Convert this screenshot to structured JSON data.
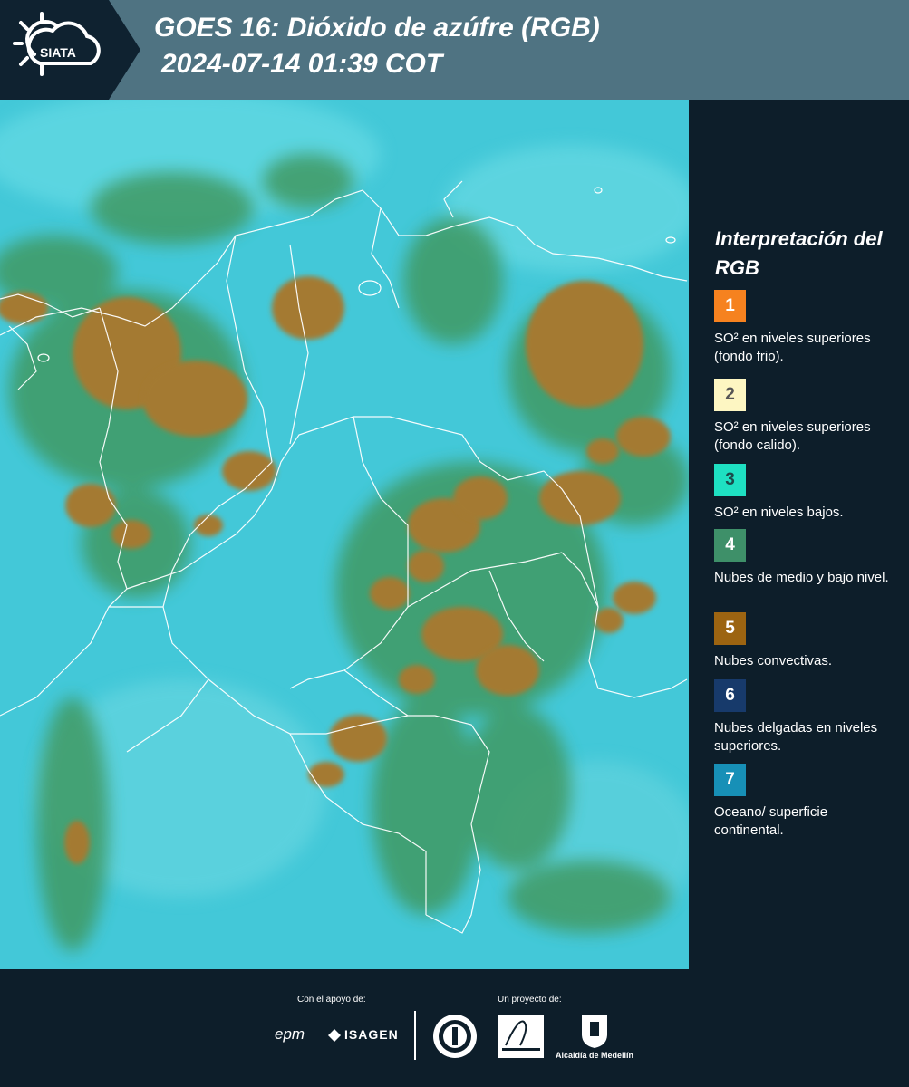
{
  "header": {
    "logo_text": "SIATA",
    "title_line1": "GOES 16: Dióxido de azúfre (RGB)",
    "title_line2": "2024-07-14 01:39 COT"
  },
  "legend": {
    "title": "Interpretación del RGB",
    "items": [
      {
        "number": "1",
        "color": "#f6821f",
        "text": "SO² en niveles superiores (fondo frio)."
      },
      {
        "number": "2",
        "color": "#fdf6c2",
        "text": "SO² en niveles superiores (fondo calido)."
      },
      {
        "number": "3",
        "color": "#1ee0c2",
        "text": "SO² en niveles bajos."
      },
      {
        "number": "4",
        "color": "#3e9069",
        "text": "Nubes de medio y bajo nivel."
      },
      {
        "number": "5",
        "color": "#9c6411",
        "text": "Nubes convectivas."
      },
      {
        "number": "6",
        "color": "#173a6b",
        "text": "Nubes delgadas en niveles superiores."
      },
      {
        "number": "7",
        "color": "#1790b7",
        "text": "Oceano/ superficie continental."
      }
    ]
  },
  "footer": {
    "support_label": "Con el apoyo de:",
    "project_label": "Un proyecto de:",
    "sponsor_epm": "epm",
    "sponsor_isagen": "ISAGEN",
    "alcaldia_label": "Alcaldía de Medellín"
  },
  "colors": {
    "map_background": "#3fc6d6",
    "convective_cloud": "#a27a2e",
    "mid_cloud": "#3a8f5c",
    "panel": "#0d1e2a",
    "header_bar": "#4f7382"
  }
}
